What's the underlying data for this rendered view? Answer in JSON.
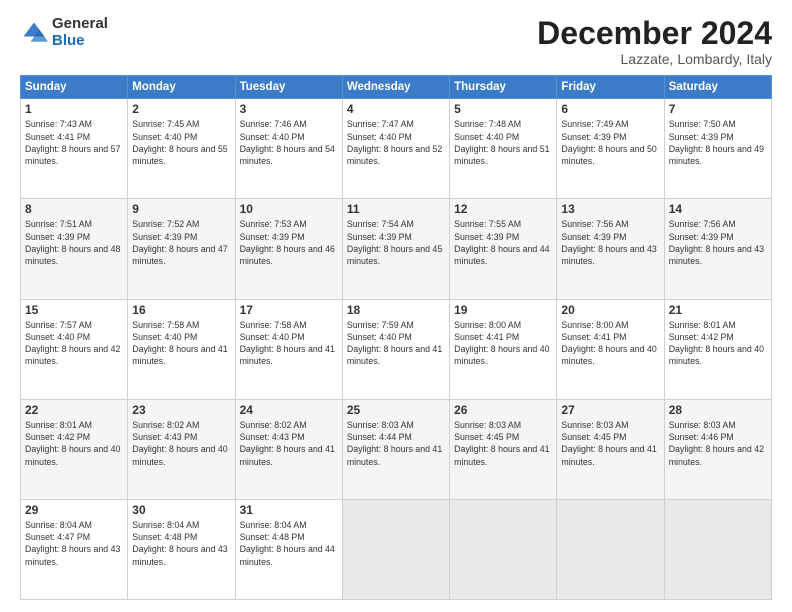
{
  "logo": {
    "general": "General",
    "blue": "Blue"
  },
  "header": {
    "month": "December 2024",
    "location": "Lazzate, Lombardy, Italy"
  },
  "weekdays": [
    "Sunday",
    "Monday",
    "Tuesday",
    "Wednesday",
    "Thursday",
    "Friday",
    "Saturday"
  ],
  "weeks": [
    [
      {
        "day": "1",
        "sunrise": "7:43 AM",
        "sunset": "4:41 PM",
        "daylight": "8 hours and 57 minutes."
      },
      {
        "day": "2",
        "sunrise": "7:45 AM",
        "sunset": "4:40 PM",
        "daylight": "8 hours and 55 minutes."
      },
      {
        "day": "3",
        "sunrise": "7:46 AM",
        "sunset": "4:40 PM",
        "daylight": "8 hours and 54 minutes."
      },
      {
        "day": "4",
        "sunrise": "7:47 AM",
        "sunset": "4:40 PM",
        "daylight": "8 hours and 52 minutes."
      },
      {
        "day": "5",
        "sunrise": "7:48 AM",
        "sunset": "4:40 PM",
        "daylight": "8 hours and 51 minutes."
      },
      {
        "day": "6",
        "sunrise": "7:49 AM",
        "sunset": "4:39 PM",
        "daylight": "8 hours and 50 minutes."
      },
      {
        "day": "7",
        "sunrise": "7:50 AM",
        "sunset": "4:39 PM",
        "daylight": "8 hours and 49 minutes."
      }
    ],
    [
      {
        "day": "8",
        "sunrise": "7:51 AM",
        "sunset": "4:39 PM",
        "daylight": "8 hours and 48 minutes."
      },
      {
        "day": "9",
        "sunrise": "7:52 AM",
        "sunset": "4:39 PM",
        "daylight": "8 hours and 47 minutes."
      },
      {
        "day": "10",
        "sunrise": "7:53 AM",
        "sunset": "4:39 PM",
        "daylight": "8 hours and 46 minutes."
      },
      {
        "day": "11",
        "sunrise": "7:54 AM",
        "sunset": "4:39 PM",
        "daylight": "8 hours and 45 minutes."
      },
      {
        "day": "12",
        "sunrise": "7:55 AM",
        "sunset": "4:39 PM",
        "daylight": "8 hours and 44 minutes."
      },
      {
        "day": "13",
        "sunrise": "7:56 AM",
        "sunset": "4:39 PM",
        "daylight": "8 hours and 43 minutes."
      },
      {
        "day": "14",
        "sunrise": "7:56 AM",
        "sunset": "4:39 PM",
        "daylight": "8 hours and 43 minutes."
      }
    ],
    [
      {
        "day": "15",
        "sunrise": "7:57 AM",
        "sunset": "4:40 PM",
        "daylight": "8 hours and 42 minutes."
      },
      {
        "day": "16",
        "sunrise": "7:58 AM",
        "sunset": "4:40 PM",
        "daylight": "8 hours and 41 minutes."
      },
      {
        "day": "17",
        "sunrise": "7:58 AM",
        "sunset": "4:40 PM",
        "daylight": "8 hours and 41 minutes."
      },
      {
        "day": "18",
        "sunrise": "7:59 AM",
        "sunset": "4:40 PM",
        "daylight": "8 hours and 41 minutes."
      },
      {
        "day": "19",
        "sunrise": "8:00 AM",
        "sunset": "4:41 PM",
        "daylight": "8 hours and 40 minutes."
      },
      {
        "day": "20",
        "sunrise": "8:00 AM",
        "sunset": "4:41 PM",
        "daylight": "8 hours and 40 minutes."
      },
      {
        "day": "21",
        "sunrise": "8:01 AM",
        "sunset": "4:42 PM",
        "daylight": "8 hours and 40 minutes."
      }
    ],
    [
      {
        "day": "22",
        "sunrise": "8:01 AM",
        "sunset": "4:42 PM",
        "daylight": "8 hours and 40 minutes."
      },
      {
        "day": "23",
        "sunrise": "8:02 AM",
        "sunset": "4:43 PM",
        "daylight": "8 hours and 40 minutes."
      },
      {
        "day": "24",
        "sunrise": "8:02 AM",
        "sunset": "4:43 PM",
        "daylight": "8 hours and 41 minutes."
      },
      {
        "day": "25",
        "sunrise": "8:03 AM",
        "sunset": "4:44 PM",
        "daylight": "8 hours and 41 minutes."
      },
      {
        "day": "26",
        "sunrise": "8:03 AM",
        "sunset": "4:45 PM",
        "daylight": "8 hours and 41 minutes."
      },
      {
        "day": "27",
        "sunrise": "8:03 AM",
        "sunset": "4:45 PM",
        "daylight": "8 hours and 41 minutes."
      },
      {
        "day": "28",
        "sunrise": "8:03 AM",
        "sunset": "4:46 PM",
        "daylight": "8 hours and 42 minutes."
      }
    ],
    [
      {
        "day": "29",
        "sunrise": "8:04 AM",
        "sunset": "4:47 PM",
        "daylight": "8 hours and 43 minutes."
      },
      {
        "day": "30",
        "sunrise": "8:04 AM",
        "sunset": "4:48 PM",
        "daylight": "8 hours and 43 minutes."
      },
      {
        "day": "31",
        "sunrise": "8:04 AM",
        "sunset": "4:48 PM",
        "daylight": "8 hours and 44 minutes."
      },
      null,
      null,
      null,
      null
    ]
  ]
}
